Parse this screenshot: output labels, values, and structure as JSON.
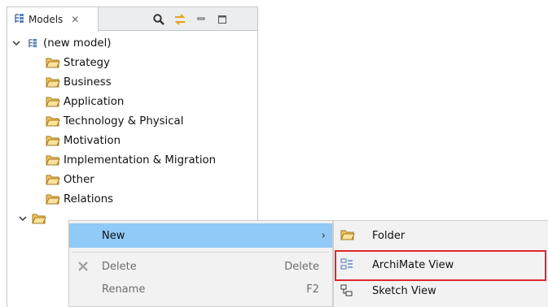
{
  "view": {
    "tab_title": "Models",
    "tab_close": "✕",
    "toolbar_icons": [
      "search-icon",
      "link-with-editor-icon",
      "minimize-icon",
      "maximize-icon"
    ]
  },
  "tree": {
    "root_label": "(new model)",
    "folders": [
      "Strategy",
      "Business",
      "Application",
      "Technology & Physical",
      "Motivation",
      "Implementation & Migration",
      "Other",
      "Relations"
    ]
  },
  "context_menu": {
    "items": [
      {
        "label": "New",
        "arrow": "›"
      },
      {
        "label": "Delete",
        "shortcut": "Delete"
      },
      {
        "label": "Rename",
        "shortcut": "F2"
      }
    ]
  },
  "submenu": {
    "items": [
      {
        "label": "Folder"
      },
      {
        "label": "ArchiMate View"
      },
      {
        "label": "Sketch View"
      }
    ]
  },
  "colors": {
    "highlight": "#91c9f7",
    "callout": "#e0262b",
    "folder": "#f2c25a"
  }
}
